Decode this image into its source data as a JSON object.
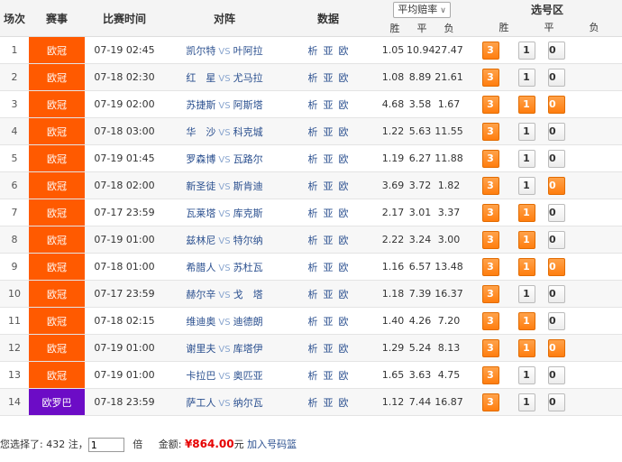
{
  "headers": {
    "idx": "场次",
    "league": "赛事",
    "time": "比赛时间",
    "match": "对阵",
    "data": "数据",
    "odds_select": "平均赔率",
    "odds_win": "胜",
    "odds_draw": "平",
    "odds_lose": "负",
    "pick_area": "选号区",
    "pick_win": "胜",
    "pick_draw": "平",
    "pick_lose": "负"
  },
  "vs_text": "VS",
  "data_links": [
    "析",
    "亚",
    "欧"
  ],
  "rows": [
    {
      "idx": "1",
      "league": "欧冠",
      "league_color": "#ff5a00",
      "time": "07-19 02:45",
      "home": "凯尔特",
      "away": "叶阿拉",
      "win": "1.05",
      "draw": "10.94",
      "lose": "27.47",
      "p3": "3",
      "p1": "1",
      "p0": "0",
      "s3": true,
      "s1": false,
      "s0": false
    },
    {
      "idx": "2",
      "league": "欧冠",
      "league_color": "#ff5a00",
      "time": "07-18 02:30",
      "home": "红　星",
      "away": "尤马拉",
      "win": "1.08",
      "draw": "8.89",
      "lose": "21.61",
      "p3": "3",
      "p1": "1",
      "p0": "0",
      "s3": true,
      "s1": false,
      "s0": false
    },
    {
      "idx": "3",
      "league": "欧冠",
      "league_color": "#ff5a00",
      "time": "07-19 02:00",
      "home": "苏捷斯",
      "away": "阿斯塔",
      "win": "4.68",
      "draw": "3.58",
      "lose": "1.67",
      "p3": "3",
      "p1": "1",
      "p0": "0",
      "s3": true,
      "s1": true,
      "s0": true
    },
    {
      "idx": "4",
      "league": "欧冠",
      "league_color": "#ff5a00",
      "time": "07-18 03:00",
      "home": "华　沙",
      "away": "科克城",
      "win": "1.22",
      "draw": "5.63",
      "lose": "11.55",
      "p3": "3",
      "p1": "1",
      "p0": "0",
      "s3": true,
      "s1": false,
      "s0": false
    },
    {
      "idx": "5",
      "league": "欧冠",
      "league_color": "#ff5a00",
      "time": "07-19 01:45",
      "home": "罗森博",
      "away": "瓦路尔",
      "win": "1.19",
      "draw": "6.27",
      "lose": "11.88",
      "p3": "3",
      "p1": "1",
      "p0": "0",
      "s3": true,
      "s1": false,
      "s0": false
    },
    {
      "idx": "6",
      "league": "欧冠",
      "league_color": "#ff5a00",
      "time": "07-18 02:00",
      "home": "新圣徒",
      "away": "斯肯迪",
      "win": "3.69",
      "draw": "3.72",
      "lose": "1.82",
      "p3": "3",
      "p1": "1",
      "p0": "0",
      "s3": true,
      "s1": false,
      "s0": true
    },
    {
      "idx": "7",
      "league": "欧冠",
      "league_color": "#ff5a00",
      "time": "07-17 23:59",
      "home": "瓦莱塔",
      "away": "库克斯",
      "win": "2.17",
      "draw": "3.01",
      "lose": "3.37",
      "p3": "3",
      "p1": "1",
      "p0": "0",
      "s3": true,
      "s1": true,
      "s0": false
    },
    {
      "idx": "8",
      "league": "欧冠",
      "league_color": "#ff5a00",
      "time": "07-19 01:00",
      "home": "兹林尼",
      "away": "特尔纳",
      "win": "2.22",
      "draw": "3.24",
      "lose": "3.00",
      "p3": "3",
      "p1": "1",
      "p0": "0",
      "s3": true,
      "s1": true,
      "s0": false
    },
    {
      "idx": "9",
      "league": "欧冠",
      "league_color": "#ff5a00",
      "time": "07-18 01:00",
      "home": "希腊人",
      "away": "苏杜瓦",
      "win": "1.16",
      "draw": "6.57",
      "lose": "13.48",
      "p3": "3",
      "p1": "1",
      "p0": "0",
      "s3": true,
      "s1": true,
      "s0": true
    },
    {
      "idx": "10",
      "league": "欧冠",
      "league_color": "#ff5a00",
      "time": "07-17 23:59",
      "home": "赫尔辛",
      "away": "戈　塔",
      "win": "1.18",
      "draw": "7.39",
      "lose": "16.37",
      "p3": "3",
      "p1": "1",
      "p0": "0",
      "s3": true,
      "s1": false,
      "s0": false
    },
    {
      "idx": "11",
      "league": "欧冠",
      "league_color": "#ff5a00",
      "time": "07-18 02:15",
      "home": "维迪奥",
      "away": "迪德朗",
      "win": "1.40",
      "draw": "4.26",
      "lose": "7.20",
      "p3": "3",
      "p1": "1",
      "p0": "0",
      "s3": true,
      "s1": true,
      "s0": false
    },
    {
      "idx": "12",
      "league": "欧冠",
      "league_color": "#ff5a00",
      "time": "07-19 01:00",
      "home": "谢里夫",
      "away": "库塔伊",
      "win": "1.29",
      "draw": "5.24",
      "lose": "8.13",
      "p3": "3",
      "p1": "1",
      "p0": "0",
      "s3": true,
      "s1": true,
      "s0": true
    },
    {
      "idx": "13",
      "league": "欧冠",
      "league_color": "#ff5a00",
      "time": "07-19 01:00",
      "home": "卡拉巴",
      "away": "奥匹亚",
      "win": "1.65",
      "draw": "3.63",
      "lose": "4.75",
      "p3": "3",
      "p1": "1",
      "p0": "0",
      "s3": true,
      "s1": false,
      "s0": false
    },
    {
      "idx": "14",
      "league": "欧罗巴",
      "league_color": "#6c0cc6",
      "time": "07-18 23:59",
      "home": "萨工人",
      "away": "纳尔瓦",
      "win": "1.12",
      "draw": "7.44",
      "lose": "16.87",
      "p3": "3",
      "p1": "1",
      "p0": "0",
      "s3": true,
      "s1": false,
      "s0": false
    }
  ],
  "footer": {
    "selected_prefix": "您选择了:",
    "notes_count": "432",
    "notes_unit": "注，",
    "multiplier_value": "1",
    "multiplier_unit": "倍",
    "amount_label": "金额:",
    "amount_value": "¥864.00",
    "amount_unit": "元",
    "add_link": "加入号码篮"
  }
}
